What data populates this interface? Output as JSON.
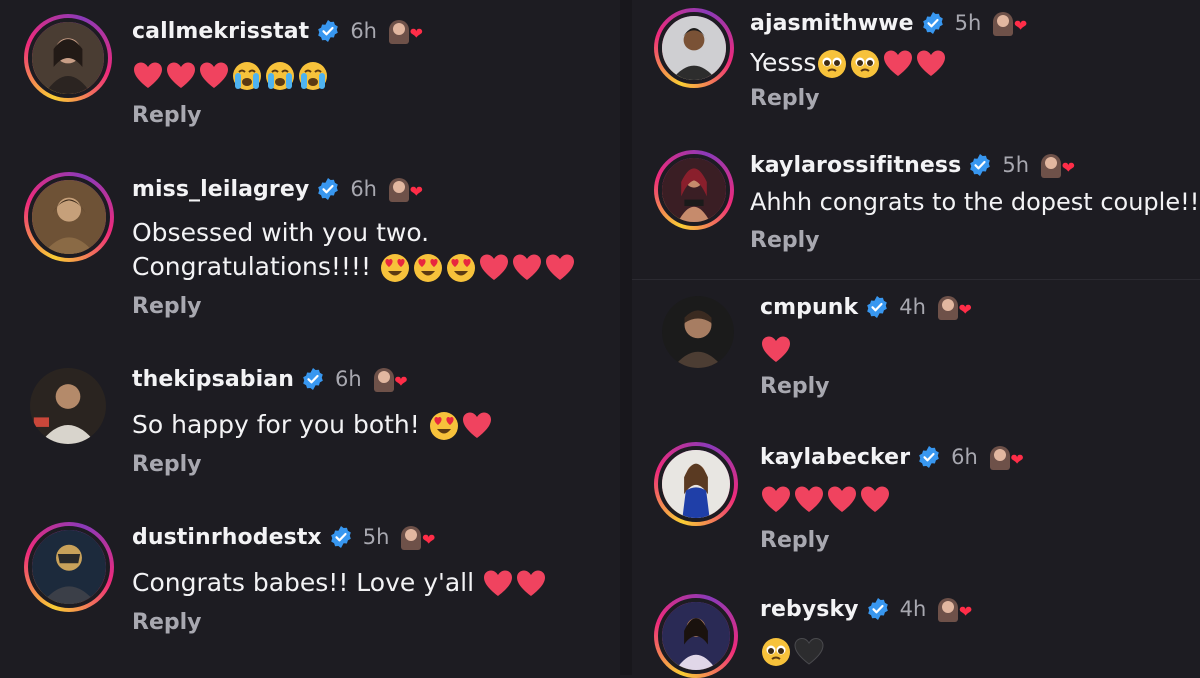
{
  "comments_left": [
    {
      "username": "callmekrisstat",
      "time": "6h",
      "text": "",
      "emojis": [
        "heart",
        "heart",
        "heart",
        "sob",
        "sob",
        "sob"
      ],
      "reply": "Reply"
    },
    {
      "username": "miss_leilagrey",
      "time": "6h",
      "text": "Obsessed with you two.",
      "text2": "Congratulations!!!!",
      "emojis": [
        "hearteyes",
        "hearteyes",
        "hearteyes",
        "heart",
        "heart",
        "heart"
      ],
      "reply": "Reply"
    },
    {
      "username": "thekipsabian",
      "time": "6h",
      "text": "So happy for you both!",
      "emojis": [
        "hearteyes",
        "heart"
      ],
      "reply": "Reply"
    },
    {
      "username": "dustinrhodestx",
      "time": "5h",
      "text": "Congrats babes!! Love y'all",
      "emojis": [
        "heart",
        "heart"
      ],
      "reply": "Reply"
    }
  ],
  "comments_right": [
    {
      "username": "ajasmithwwe",
      "time": "5h",
      "text": "Yesss",
      "emojis": [
        "pleading",
        "pleading",
        "heart",
        "heart"
      ],
      "reply": "Reply"
    },
    {
      "username": "kaylarossifitness",
      "time": "5h",
      "text": "Ahhh congrats to the dopest couple!!",
      "emojis": [],
      "reply": "Reply"
    },
    {
      "username": "cmpunk",
      "time": "4h",
      "text": "",
      "emojis": [
        "heart"
      ],
      "reply": "Reply"
    },
    {
      "username": "kaylabecker",
      "time": "6h",
      "text": "",
      "emojis": [
        "heart",
        "heart",
        "heart",
        "heart"
      ],
      "reply": "Reply"
    },
    {
      "username": "rebysky",
      "time": "4h",
      "text": "",
      "emojis": [
        "pleading",
        "blackheart"
      ],
      "reply": ""
    }
  ],
  "colors": {
    "background": "#1d1c22",
    "text": "#f3f3f5",
    "muted": "#a8a8b0",
    "verified": "#3897f0",
    "heart": "#f0435f"
  }
}
